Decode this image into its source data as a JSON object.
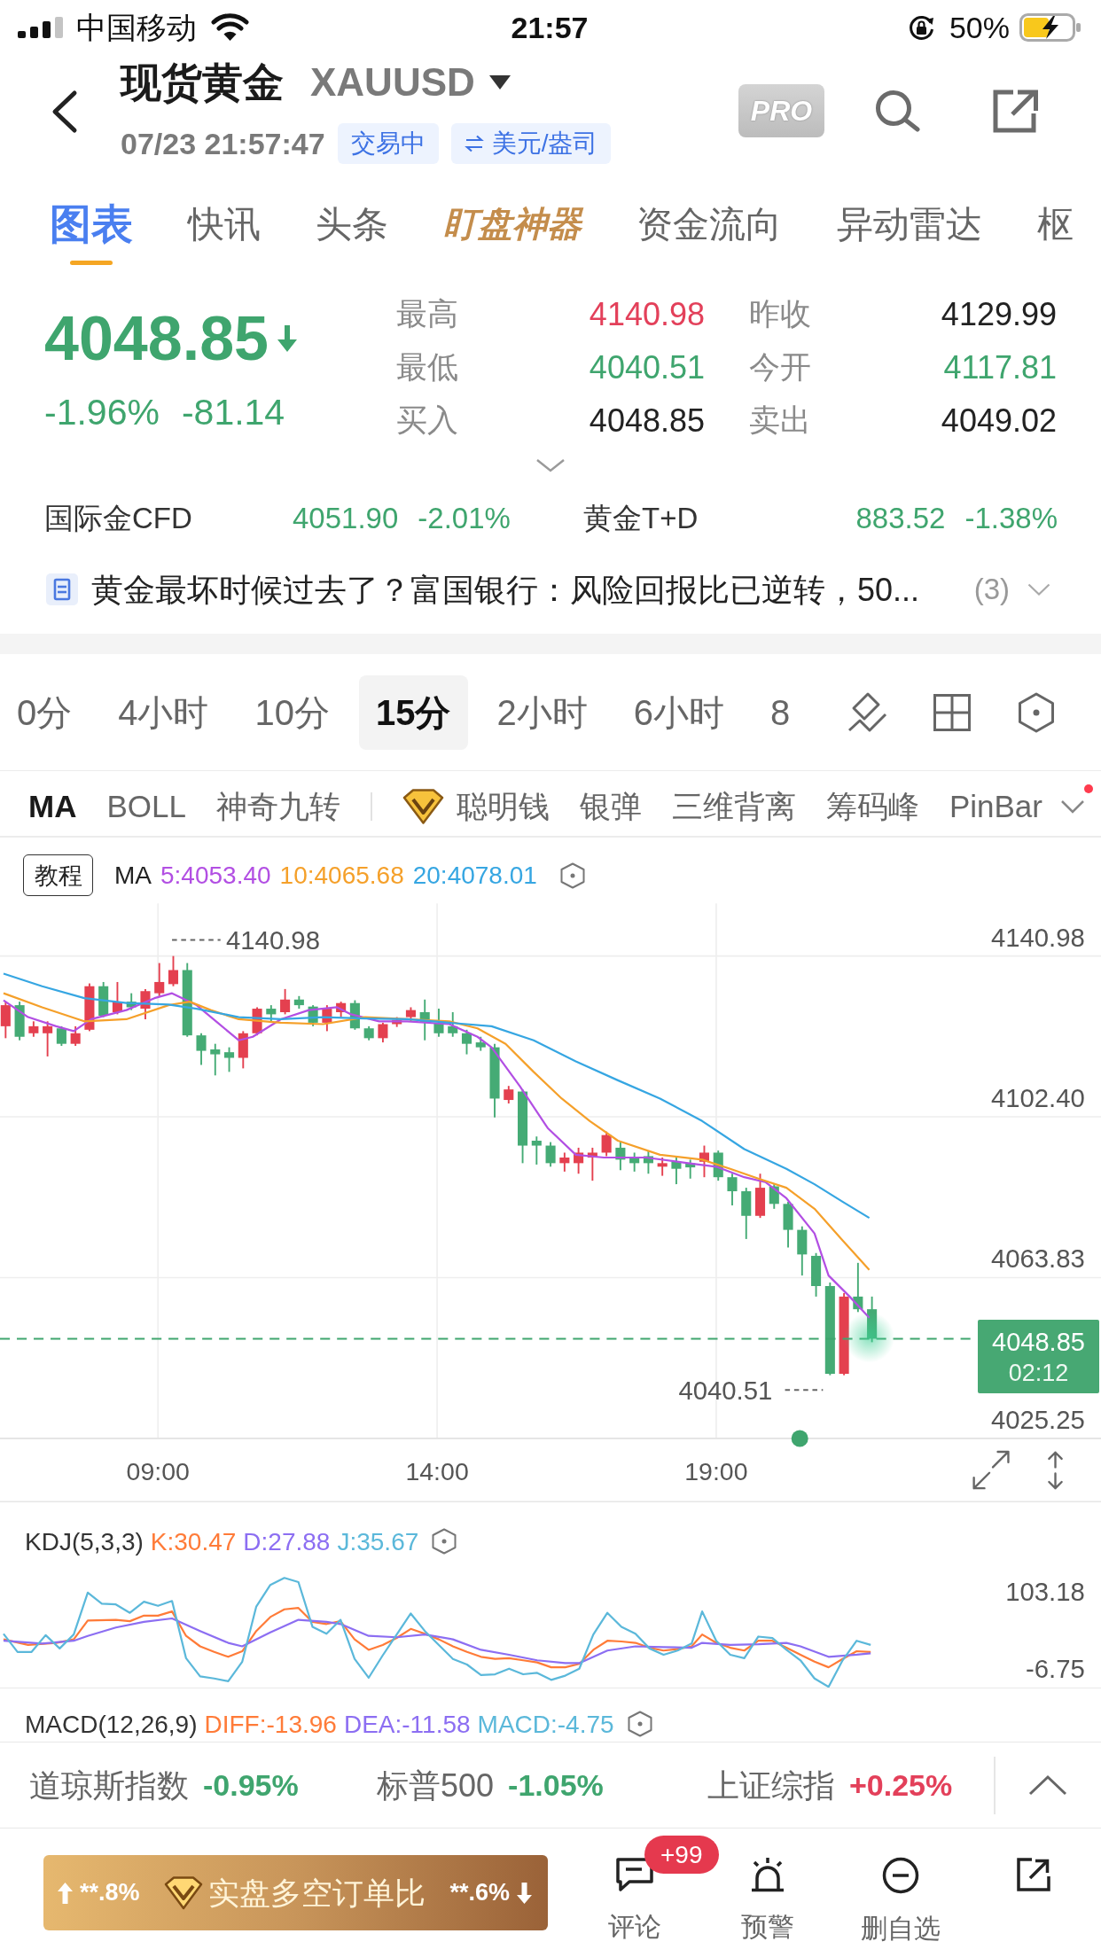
{
  "status_bar": {
    "carrier": "中国移动",
    "time": "21:57",
    "battery": "50%"
  },
  "header": {
    "title": "现货黄金",
    "symbol": "XAUUSD",
    "datetime": "07/23 21:57:47",
    "badges": [
      {
        "kind": "status",
        "text": "交易中"
      },
      {
        "kind": "unit",
        "text": "美元/盎司"
      }
    ],
    "pro_label": "PRO"
  },
  "tabs": [
    {
      "label": "图表",
      "kind": "text",
      "selected": true
    },
    {
      "label": "快讯",
      "kind": "text",
      "selected": false
    },
    {
      "label": "头条",
      "kind": "text",
      "selected": false
    },
    {
      "label": "盯盘神器",
      "kind": "brand",
      "selected": false
    },
    {
      "label": "资金流向",
      "kind": "text",
      "selected": false
    },
    {
      "label": "异动雷达",
      "kind": "text",
      "selected": false
    },
    {
      "label": "枢",
      "kind": "text",
      "selected": false
    }
  ],
  "quote": {
    "price": "4048.85",
    "falling": true,
    "change_pct": "-1.96%",
    "change": "-81.14"
  },
  "stats": [
    {
      "label": "最高",
      "value": "4140.98",
      "color": "#e3405a"
    },
    {
      "label": "昨收",
      "value": "4129.99",
      "color": "#222222"
    },
    {
      "label": "最低",
      "value": "4040.51",
      "color": "#3fa56e"
    },
    {
      "label": "今开",
      "value": "4117.81",
      "color": "#3fa56e"
    },
    {
      "label": "买入",
      "value": "4048.85",
      "color": "#222222"
    },
    {
      "label": "卖出",
      "value": "4049.02",
      "color": "#222222"
    }
  ],
  "related": [
    {
      "name": "国际金CFD",
      "price": "4051.90",
      "change": "-2.01%",
      "color": "#3fa56e"
    },
    {
      "name": "黄金T+D",
      "price": "883.52",
      "change": "-1.38%",
      "color": "#3fa56e"
    }
  ],
  "news": {
    "headline": "黄金最坏时候过去了？富国银行：风险回报比已逆转，50...",
    "count": "(3)"
  },
  "periods": [
    {
      "label": "0分",
      "selected": false
    },
    {
      "label": "4小时",
      "selected": false
    },
    {
      "label": "10分",
      "selected": false
    },
    {
      "label": "15分",
      "selected": true
    },
    {
      "label": "2小时",
      "selected": false
    },
    {
      "label": "6小时",
      "selected": false
    },
    {
      "label": "8",
      "selected": false
    }
  ],
  "indicators": [
    {
      "label": "MA",
      "selected": true
    },
    {
      "label": "BOLL",
      "selected": false
    },
    {
      "label": "神奇九转",
      "selected": false
    }
  ],
  "premium_indicators": [
    {
      "label": "聪明钱",
      "selected": false
    },
    {
      "label": "银弹",
      "selected": false
    },
    {
      "label": "三维背离",
      "selected": false
    },
    {
      "label": "筹码峰",
      "selected": false
    },
    {
      "label": "PinBar",
      "selected": false
    }
  ],
  "indicator_menu": {
    "has_new": true
  },
  "chart": {
    "tutorial_button": "教程",
    "ma_label": "MA",
    "ma_values": [
      {
        "text": "5:4053.40",
        "color": "#b24fe3"
      },
      {
        "text": "10:4065.68",
        "color": "#f5a02a"
      },
      {
        "text": "20:4078.01",
        "color": "#36a6e2"
      }
    ],
    "y_labels": [
      "4140.98",
      "4102.40",
      "4063.83",
      "4025.25"
    ],
    "high_label": "4140.98",
    "low_label": "4040.51",
    "last_price": "4048.85",
    "countdown": "02:12",
    "x_labels": [
      "09:00",
      "14:00",
      "19:00"
    ]
  },
  "kdj": {
    "label": "KDJ(5,3,3)",
    "values": [
      {
        "text": "K:30.47",
        "color": "#ff7b38"
      },
      {
        "text": "D:27.88",
        "color": "#8c6ef2"
      },
      {
        "text": "J:35.67",
        "color": "#5bb8da"
      }
    ],
    "y_labels": [
      "103.18",
      "-6.75"
    ]
  },
  "macd": {
    "label": "MACD(12,26,9)",
    "values": [
      {
        "text": "DIFF:-13.96",
        "color": "#ff7b38"
      },
      {
        "text": "DEA:-11.58",
        "color": "#8c6ef2"
      },
      {
        "text": "MACD:-4.75",
        "color": "#5bb8da"
      }
    ]
  },
  "tickers": [
    {
      "name": "道琼斯指数",
      "change": "-0.95%",
      "color": "#3fa56e"
    },
    {
      "name": "标普500",
      "change": "-1.05%",
      "color": "#3fa56e"
    },
    {
      "name": "上证综指",
      "change": "+0.25%",
      "color": "#e3405a"
    }
  ],
  "toolbar": {
    "ratio": {
      "long": "**.8%",
      "title": "实盘多空订单比",
      "short": "**.6%"
    },
    "actions": [
      {
        "kind": "comment",
        "label": "评论",
        "badge": "+99"
      },
      {
        "kind": "alert",
        "label": "预警"
      },
      {
        "kind": "remove",
        "label": "删自选"
      },
      {
        "kind": "share"
      }
    ]
  }
}
